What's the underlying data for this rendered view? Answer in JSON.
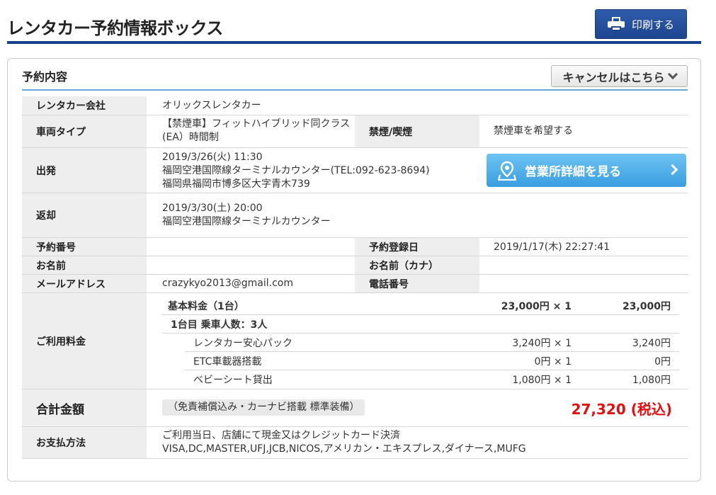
{
  "page": {
    "title": "レンタカー予約情報ボックス",
    "print_label": "印刷する"
  },
  "panel": {
    "title": "予約内容",
    "cancel_label": "キャンセルはこちら"
  },
  "rows": {
    "company": {
      "label": "レンタカー会社",
      "value": "オリックスレンタカー"
    },
    "vehicle": {
      "label": "車両タイプ",
      "value_line1": "【禁煙車】フィットハイブリッド同クラス",
      "value_line2": "(EA）時間制",
      "smoking_label": "禁煙/喫煙",
      "smoking_value": "禁煙車を希望する"
    },
    "departure": {
      "label": "出発",
      "datetime": "2019/3/26(火) 11:30",
      "office": "福岡空港国際線ターミナルカウンター(TEL:092-623-8694)",
      "address": "福岡県福岡市博多区大字青木739",
      "office_button_label": "営業所詳細を見る"
    },
    "return": {
      "label": "返却",
      "datetime": "2019/3/30(土) 20:00",
      "office": "福岡空港国際線ターミナルカウンター"
    },
    "reservation": {
      "number_label": "予約番号",
      "number_value": "",
      "registered_label": "予約登録日",
      "registered_value": "2019/1/17(木) 22:27:41"
    },
    "name": {
      "label": "お名前",
      "value": "",
      "kana_label": "お名前（カナ）",
      "kana_value": ""
    },
    "contact": {
      "email_label": "メールアドレス",
      "email_value": "crazykyo2013@gmail.com",
      "phone_label": "電話番号",
      "phone_value": ""
    }
  },
  "fees": {
    "label": "ご利用料金",
    "base": {
      "name": "基本料金（1台）",
      "unit": "23,000円 × 1",
      "total": "23,000円"
    },
    "day_header": "1台目  乗車人数：3人",
    "options": [
      {
        "name": "レンタカー安心パック",
        "unit": "3,240円 × 1",
        "total": "3,240円"
      },
      {
        "name": "ETC車載器搭載",
        "unit": "0円 × 1",
        "total": "0円"
      },
      {
        "name": "ベビーシート貸出",
        "unit": "1,080円 × 1",
        "total": "1,080円"
      }
    ]
  },
  "total": {
    "label": "合計金額",
    "note": "（免責補償込み・カーナビ搭載 標準装備）",
    "amount": "27,320 (税込)"
  },
  "payment": {
    "label": "お支払方法",
    "line1": "ご利用当日、店舗にて現金又はクレジットカード決済",
    "line2": "VISA,DC,MASTER,UFJ,JCB,NICOS,アメリカン・エキスプレス,ダイナース,MUFG"
  },
  "colors": {
    "accent": "#1a3f8a",
    "panel_rule": "#64a8d8",
    "office_button": "#4aaee8",
    "total_amount": "#e01010",
    "label_bg": "#eeeeee"
  },
  "icons": {
    "print": "printer-icon",
    "cancel": "chevron-down-icon",
    "office": "map-pin-icon",
    "office_arrow": "chevron-right-icon"
  }
}
